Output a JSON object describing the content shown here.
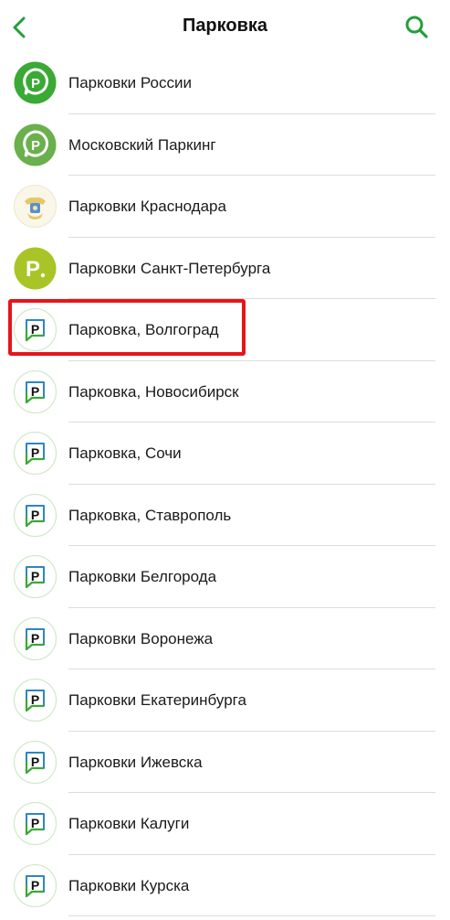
{
  "header": {
    "title": "Парковка",
    "back_icon": "chevron-left-icon",
    "search_icon": "search-icon",
    "accent_color": "#21a038"
  },
  "items": [
    {
      "label": "Парковки России",
      "icon": "parking-pin-green-icon"
    },
    {
      "label": "Московский Паркинг",
      "icon": "parking-pin-green-icon"
    },
    {
      "label": "Парковки Краснодара",
      "icon": "krasnodar-emblem-icon"
    },
    {
      "label": "Парковки Санкт-Петербурга",
      "icon": "parking-lime-circle-icon"
    },
    {
      "label": "Парковка, Волгоград",
      "icon": "parking-p-bubble-icon"
    },
    {
      "label": "Парковка, Новосибирск",
      "icon": "parking-p-bubble-icon"
    },
    {
      "label": "Парковка, Сочи",
      "icon": "parking-p-bubble-icon"
    },
    {
      "label": "Парковка, Ставрополь",
      "icon": "parking-p-bubble-icon"
    },
    {
      "label": "Парковки Белгорода",
      "icon": "parking-p-bubble-icon"
    },
    {
      "label": "Парковки Воронежа",
      "icon": "parking-p-bubble-icon"
    },
    {
      "label": "Парковки Екатеринбурга",
      "icon": "parking-p-bubble-icon"
    },
    {
      "label": "Парковки Ижевска",
      "icon": "parking-p-bubble-icon"
    },
    {
      "label": "Парковки Калуги",
      "icon": "parking-p-bubble-icon"
    },
    {
      "label": "Парковки Курска",
      "icon": "parking-p-bubble-icon"
    }
  ],
  "highlight_color": "#e8141a"
}
